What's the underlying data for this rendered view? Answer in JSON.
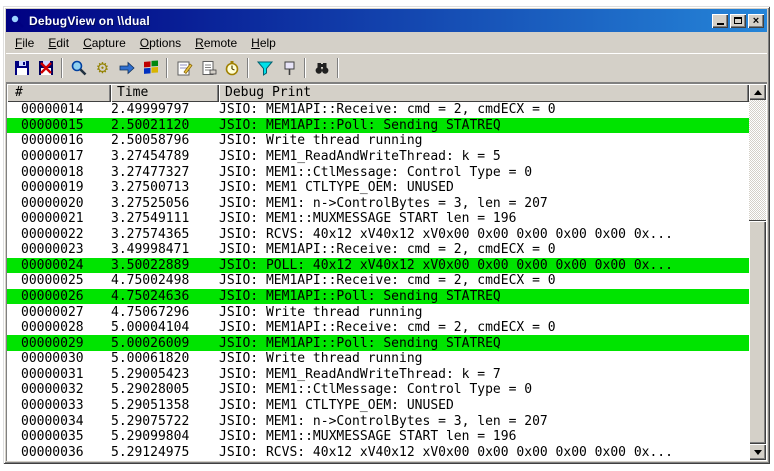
{
  "colors": {
    "chrome": "#d4d0c8",
    "titlebar_left": "#000082",
    "titlebar_right": "#2585d8",
    "highlight": "#00e400"
  },
  "window": {
    "title": "DebugView on \\\\dual",
    "app_icon": "magnifier-icon",
    "caption_buttons": [
      "minimize",
      "maximize",
      "close"
    ]
  },
  "menu": {
    "items": [
      {
        "label": "File"
      },
      {
        "label": "Edit"
      },
      {
        "label": "Capture"
      },
      {
        "label": "Options"
      },
      {
        "label": "Remote"
      },
      {
        "label": "Help"
      }
    ]
  },
  "toolbar": {
    "buttons": [
      "floppy-save-icon",
      "floppy-log-icon",
      "magnifier-icon",
      "gear-icon",
      "arrow-right-icon",
      "windows-logo-icon",
      "clipboard-pencil-icon",
      "document-icon",
      "stopwatch-icon",
      "filter-funnel-icon",
      "highlight-marker-icon",
      "binoculars-icon"
    ]
  },
  "log": {
    "columns": [
      "#",
      "Time",
      "Debug Print"
    ],
    "rows": [
      {
        "seq": "00000014",
        "time": "2.49999797",
        "msg": "JSIO: MEM1API::Receive: cmd = 2, cmdECX = 0",
        "highlight": false
      },
      {
        "seq": "00000015",
        "time": "2.50021120",
        "msg": "JSIO: MEM1API::Poll: Sending STATREQ",
        "highlight": true
      },
      {
        "seq": "00000016",
        "time": "2.50058796",
        "msg": "JSIO: Write thread running",
        "highlight": false
      },
      {
        "seq": "00000017",
        "time": "3.27454789",
        "msg": "JSIO: MEM1_ReadAndWriteThread: k = 5",
        "highlight": false
      },
      {
        "seq": "00000018",
        "time": "3.27477327",
        "msg": "JSIO: MEM1::CtlMessage: Control Type = 0",
        "highlight": false
      },
      {
        "seq": "00000019",
        "time": "3.27500713",
        "msg": "JSIO: MEM1 CTLTYPE_OEM: UNUSED",
        "highlight": false
      },
      {
        "seq": "00000020",
        "time": "3.27525056",
        "msg": "JSIO: MEM1: n->ControlBytes = 3, len = 207",
        "highlight": false
      },
      {
        "seq": "00000021",
        "time": "3.27549111",
        "msg": "JSIO: MEM1::MUXMESSAGE START len = 196",
        "highlight": false
      },
      {
        "seq": "00000022",
        "time": "3.27574365",
        "msg": "JSIO: RCVS: 40x12 xV40x12 xV0x00 0x00 0x00 0x00 0x00 0x...",
        "highlight": false
      },
      {
        "seq": "00000023",
        "time": "3.49998471",
        "msg": "JSIO: MEM1API::Receive: cmd = 2, cmdECX = 0",
        "highlight": false
      },
      {
        "seq": "00000024",
        "time": "3.50022889",
        "msg": "JSIO: POLL: 40x12 xV40x12 xV0x00 0x00 0x00 0x00 0x00 0x...",
        "highlight": true
      },
      {
        "seq": "00000025",
        "time": "4.75002498",
        "msg": "JSIO: MEM1API::Receive: cmd = 2, cmdECX = 0",
        "highlight": false
      },
      {
        "seq": "00000026",
        "time": "4.75024636",
        "msg": "JSIO: MEM1API::Poll: Sending STATREQ",
        "highlight": true
      },
      {
        "seq": "00000027",
        "time": "4.75067296",
        "msg": "JSIO: Write thread running",
        "highlight": false
      },
      {
        "seq": "00000028",
        "time": "5.00004104",
        "msg": "JSIO: MEM1API::Receive: cmd = 2, cmdECX = 0",
        "highlight": false
      },
      {
        "seq": "00000029",
        "time": "5.00026009",
        "msg": "JSIO: MEM1API::Poll: Sending STATREQ",
        "highlight": true
      },
      {
        "seq": "00000030",
        "time": "5.00061820",
        "msg": "JSIO: Write thread running",
        "highlight": false
      },
      {
        "seq": "00000031",
        "time": "5.29005423",
        "msg": "JSIO: MEM1_ReadAndWriteThread: k = 7",
        "highlight": false
      },
      {
        "seq": "00000032",
        "time": "5.29028005",
        "msg": "JSIO: MEM1::CtlMessage: Control Type = 0",
        "highlight": false
      },
      {
        "seq": "00000033",
        "time": "5.29051358",
        "msg": "JSIO: MEM1 CTLTYPE_OEM: UNUSED",
        "highlight": false
      },
      {
        "seq": "00000034",
        "time": "5.29075722",
        "msg": "JSIO: MEM1: n->ControlBytes = 3, len = 207",
        "highlight": false
      },
      {
        "seq": "00000035",
        "time": "5.29099804",
        "msg": "JSIO: MEM1::MUXMESSAGE START len = 196",
        "highlight": false
      },
      {
        "seq": "00000036",
        "time": "5.29124975",
        "msg": "JSIO: RCVS: 40x12 xV40x12 xV0x00 0x00 0x00 0x00 0x00 0x...",
        "highlight": false
      }
    ]
  }
}
